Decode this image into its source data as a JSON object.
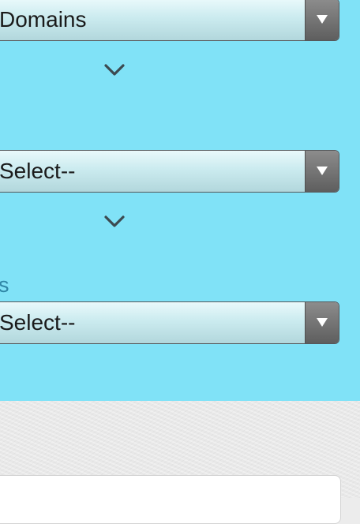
{
  "filters": [
    {
      "value": "Domains",
      "arrow_icon": "triangle-down-icon"
    },
    {
      "value": "Select--",
      "arrow_icon": "triangle-down-icon"
    },
    {
      "value": "Select--",
      "arrow_icon": "triangle-down-icon"
    }
  ],
  "third_filter_label": "s",
  "icons": {
    "expand": "chevron-down-icon"
  },
  "colors": {
    "panel_background": "#80e2f7",
    "label_text": "#2f86a6",
    "page_background": "#ececec"
  }
}
